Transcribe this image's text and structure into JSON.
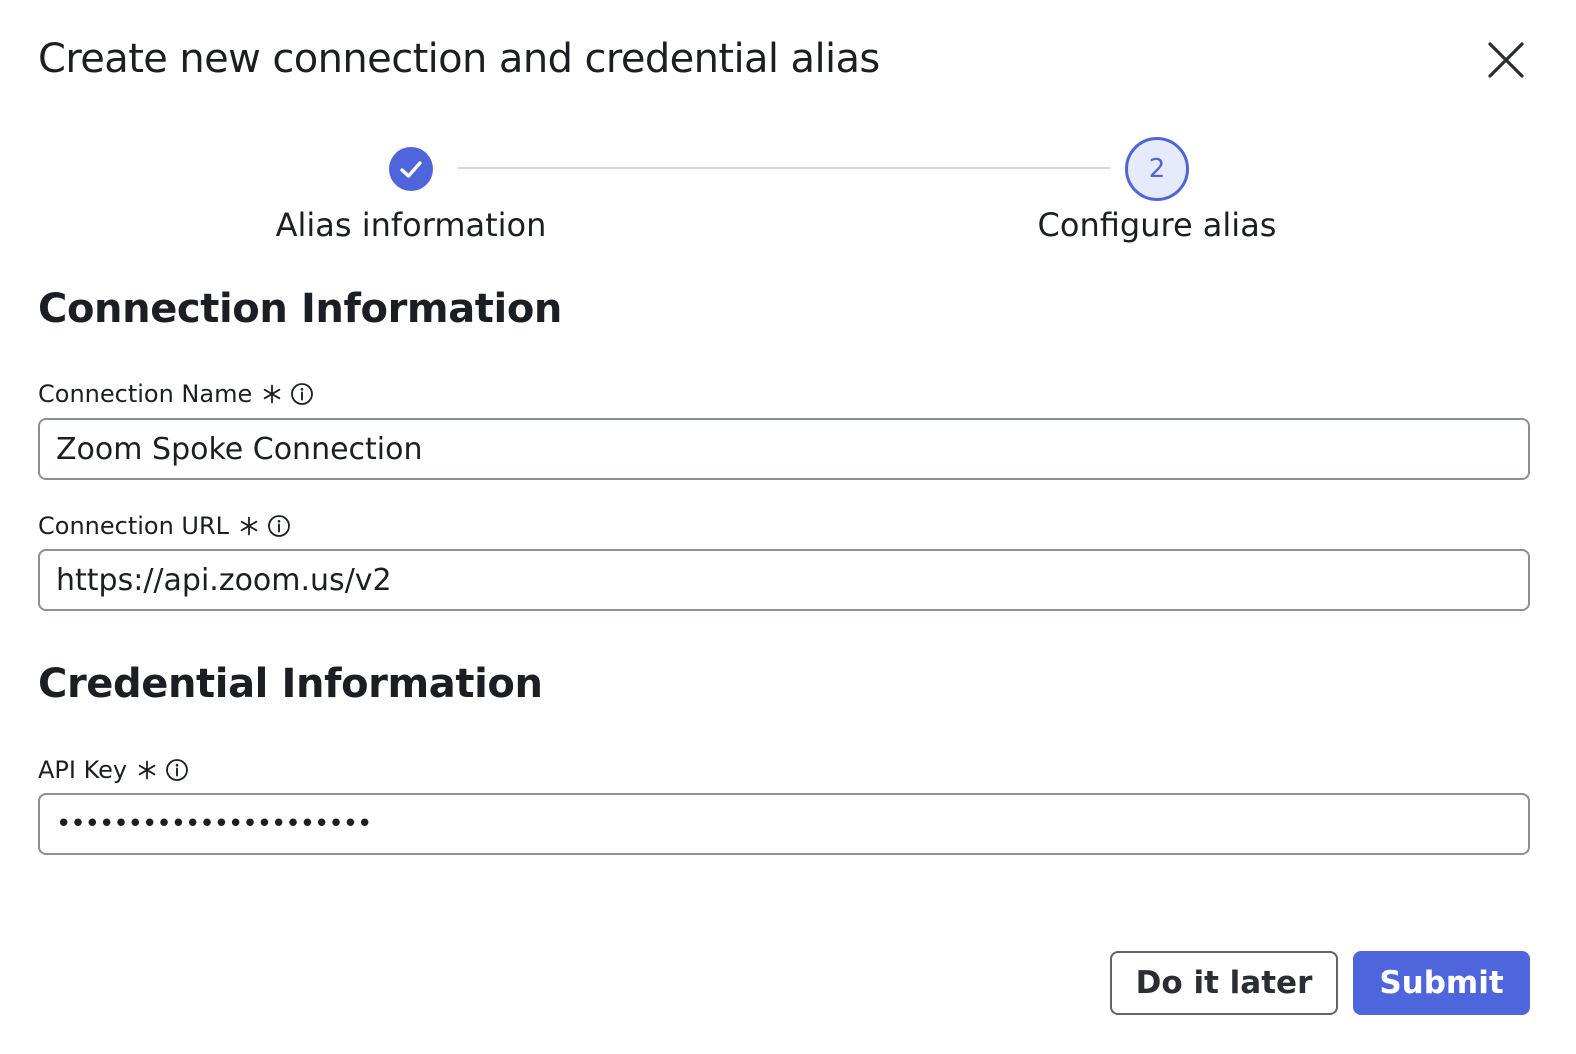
{
  "dialog": {
    "title": "Create new connection and credential alias",
    "close_icon": "close-icon"
  },
  "stepper": {
    "steps": [
      {
        "label": "Alias information",
        "status": "completed",
        "icon": "check-icon"
      },
      {
        "label": "Configure alias",
        "status": "current",
        "number": "2"
      }
    ],
    "accent_color": "#4f65dc"
  },
  "connection_section": {
    "heading": "Connection Information",
    "fields": [
      {
        "label": "Connection Name",
        "required_icon": "asterisk-icon",
        "info_icon": "info-icon",
        "value": "Zoom Spoke Connection"
      },
      {
        "label": "Connection URL",
        "required_icon": "asterisk-icon",
        "info_icon": "info-icon",
        "value": "https://api.zoom.us/v2"
      }
    ]
  },
  "credential_section": {
    "heading": "Credential Information",
    "fields": [
      {
        "label": "API Key",
        "required_icon": "asterisk-icon",
        "info_icon": "info-icon",
        "value": "••••••••••••••••••••••"
      }
    ]
  },
  "footer": {
    "secondary_button": "Do it later",
    "primary_button": "Submit",
    "primary_color": "#4f65dc"
  }
}
